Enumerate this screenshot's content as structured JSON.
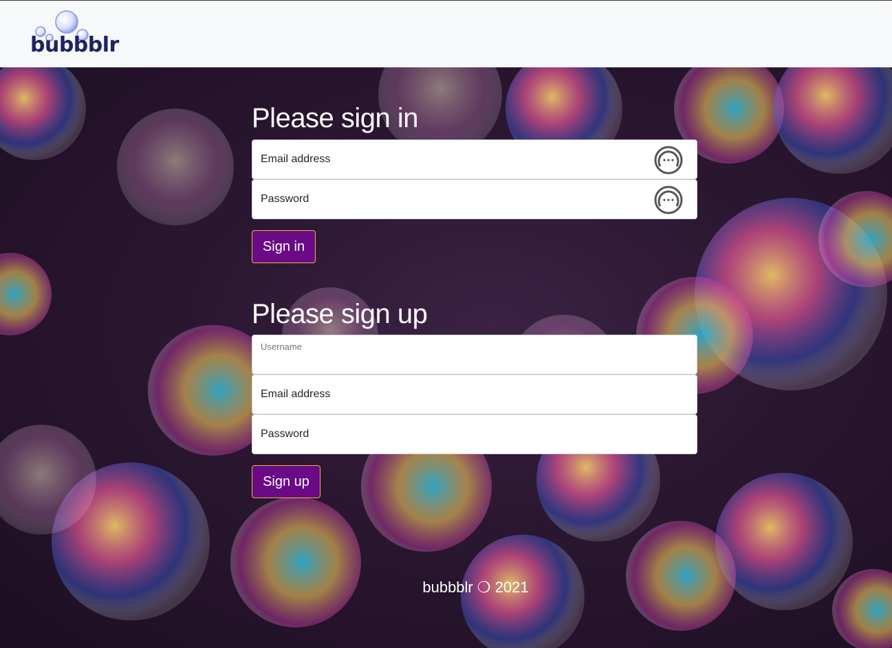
{
  "brand": {
    "name": "bubbblr"
  },
  "sign_in": {
    "heading": "Please sign in",
    "email_label": "Email address",
    "password_label": "Password",
    "button_label": "Sign in"
  },
  "sign_up": {
    "heading": "Please sign up",
    "username_label": "Username",
    "email_label": "Email address",
    "password_label": "Password",
    "button_label": "Sign up"
  },
  "footer": {
    "text": "bubbblr ❍ 2021"
  },
  "colors": {
    "accent": "#6b0a86",
    "button_border": "#e8b936",
    "navbar_bg": "#f7f8fa",
    "logo_text": "#1e2461"
  },
  "icons": {
    "password_manager": "password-manager-icon",
    "logo_bubbles": "bubbles-icon"
  }
}
